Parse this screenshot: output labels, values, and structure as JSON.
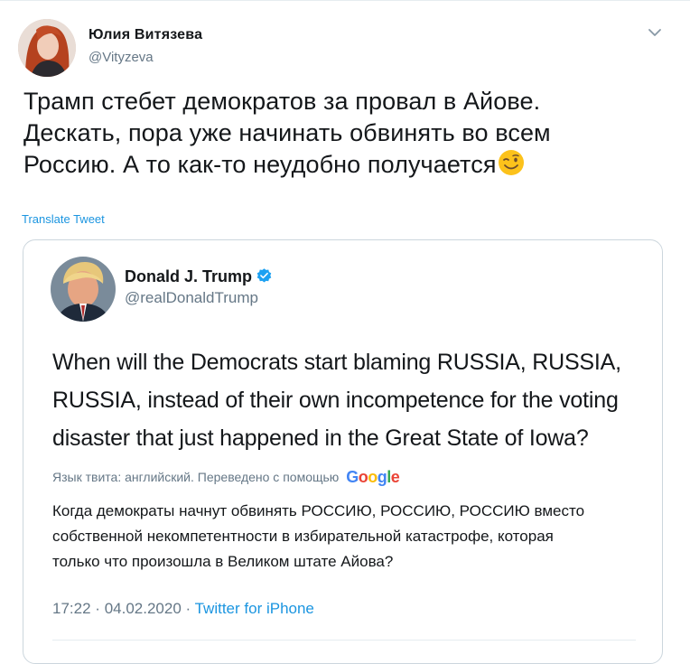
{
  "tweet": {
    "author_name": "Юлия Витязева",
    "author_handle": "@Vityzeva",
    "text_lines": [
      "Трамп стебет демократов за провал в Айове.",
      "Дескать, пора уже начинать обвинять во всем",
      "Россию. А то как-то неудобно получается"
    ],
    "emoji": "winking-face",
    "translate_label": "Translate Tweet",
    "menu_icon": "chevron-down-icon"
  },
  "quoted_tweet": {
    "author_name": "Donald J. Trump",
    "author_handle": "@realDonaldTrump",
    "verified": true,
    "text_lines": [
      "When will the Democrats start blaming RUSSIA, RUSSIA,",
      "RUSSIA, instead of their own incompetence for the voting",
      "disaster that just happened in the Great State of Iowa?"
    ],
    "translation_meta": "Язык твита: английский. Переведено с помощью",
    "translation_provider": "Google",
    "translation_lines": [
      "Когда демократы начнут обвинять РОССИЮ, РОССИЮ, РОССИЮ вместо",
      "собственной некомпетентности в избирательной катастрофе, которая",
      "только что произошла в Великом штате Айова?"
    ],
    "time": "17:22",
    "separator": "·",
    "date": "04.02.2020",
    "source": "Twitter for iPhone"
  },
  "colors": {
    "link": "#1b95e0",
    "secondary_text": "#657786",
    "border": "#ccd6dd",
    "verified_badge": "#1da1f2"
  }
}
